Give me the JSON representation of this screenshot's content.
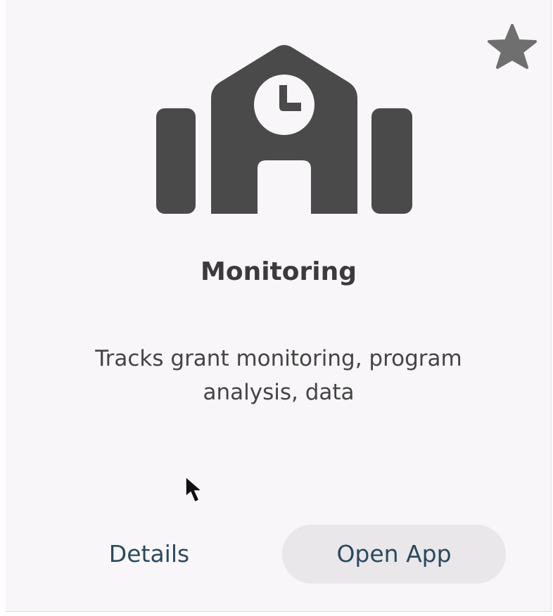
{
  "card": {
    "title": "Monitoring",
    "description": "Tracks grant monitoring, program analysis, data",
    "icon": "school-building-clock-icon",
    "favorite_icon": "star-icon"
  },
  "actions": {
    "details_label": "Details",
    "open_label": "Open App"
  },
  "colors": {
    "card_background": "#f8f6f8",
    "icon": "#4a4a4a",
    "star": "#6f6f6f",
    "button_text": "#2b4a5e",
    "button_background": "#e9e7e9"
  }
}
